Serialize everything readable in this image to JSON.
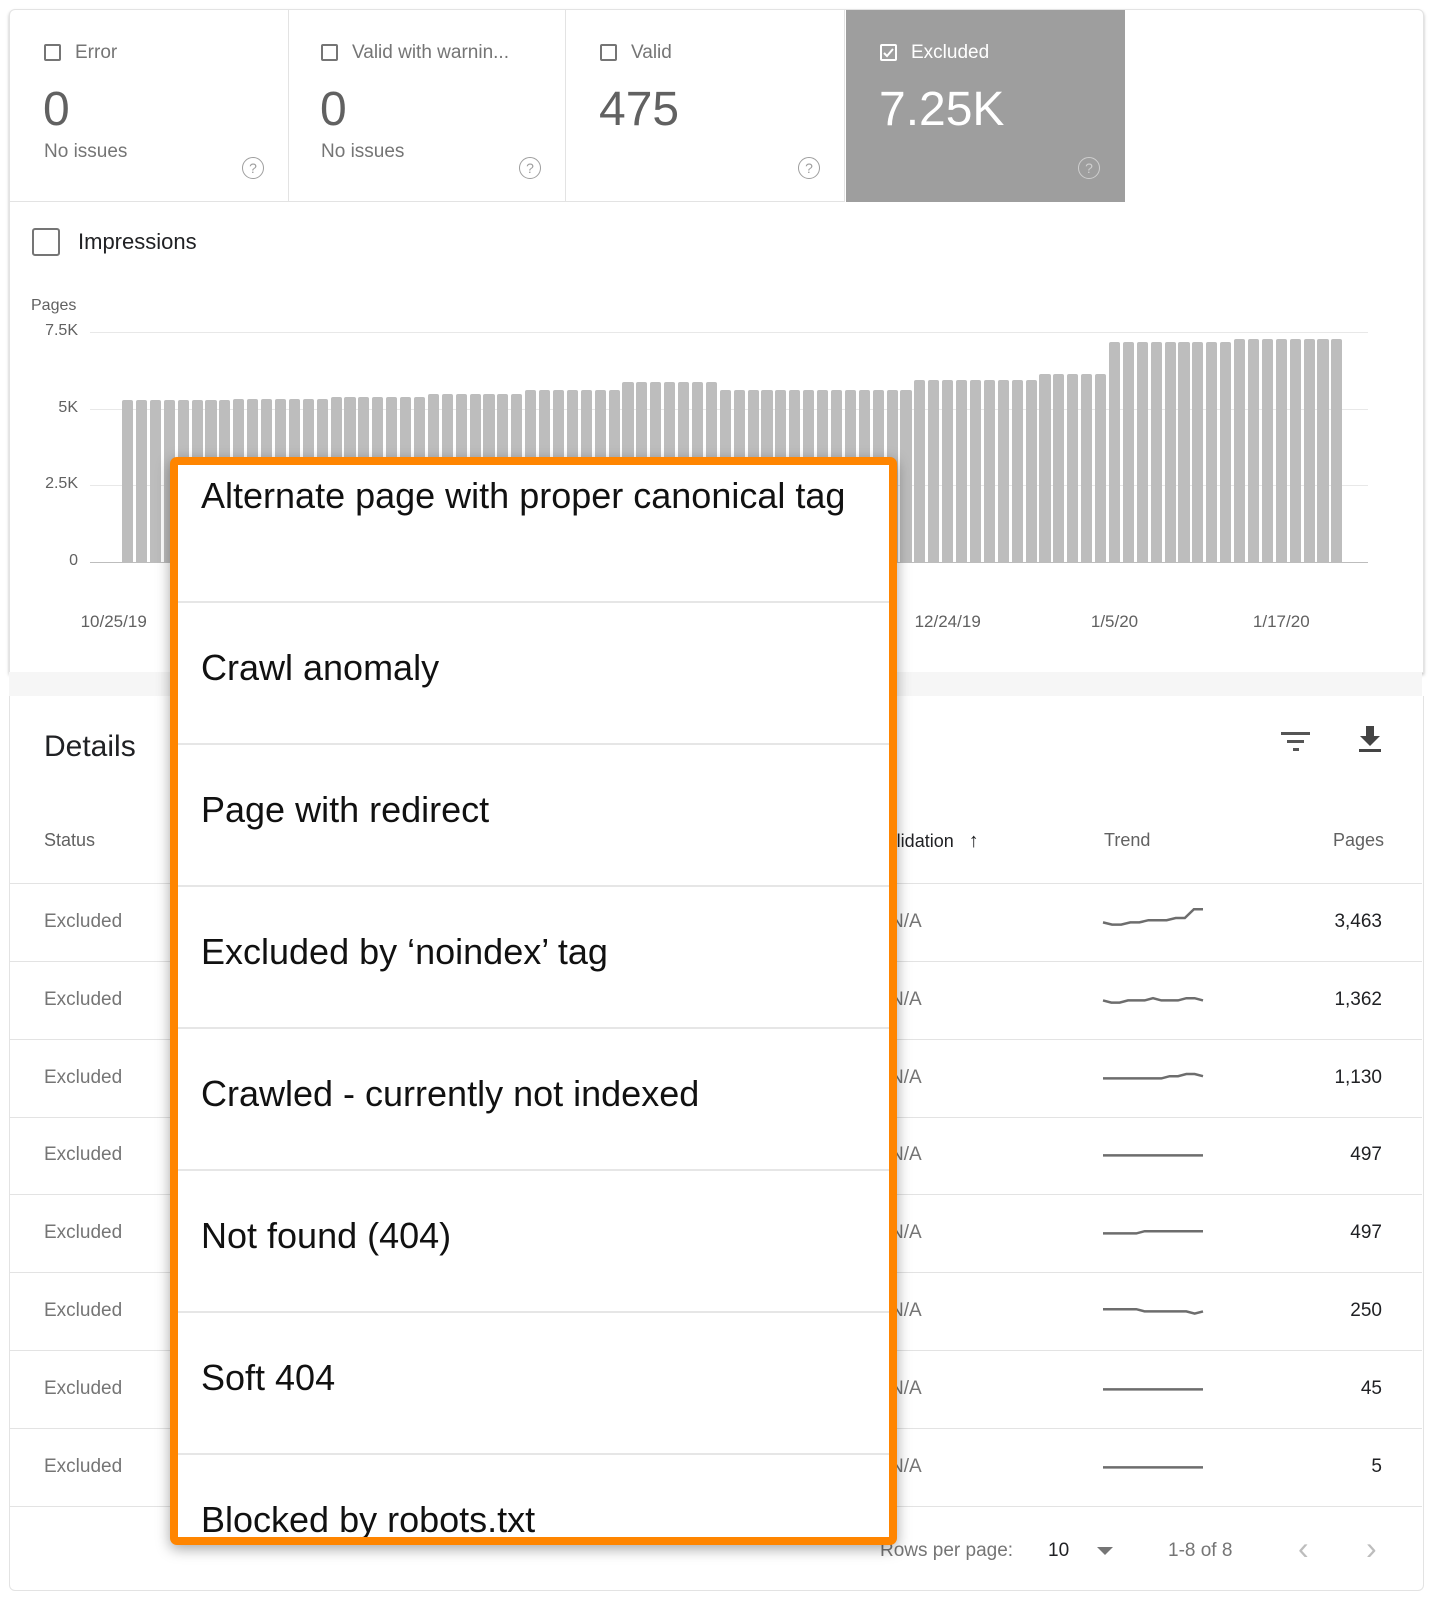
{
  "tiles": [
    {
      "label": "Error",
      "count": "0",
      "sub": "No issues",
      "checked": false
    },
    {
      "label": "Valid with warnin...",
      "count": "0",
      "sub": "No issues",
      "checked": false
    },
    {
      "label": "Valid",
      "count": "475",
      "sub": "",
      "checked": false
    },
    {
      "label": "Excluded",
      "count": "7.25K",
      "sub": "",
      "checked": true
    }
  ],
  "help_glyph": "?",
  "impressions_label": "Impressions",
  "colors": {
    "accent_highlight": "#ff8500",
    "selected_tile": "#9e9e9e",
    "bar": "#bdbdbd"
  },
  "chart_data": {
    "type": "bar",
    "ylabel": "Pages",
    "ylim": [
      0,
      7500
    ],
    "yticks": [
      "0",
      "2.5K",
      "5K",
      "7.5K"
    ],
    "ytick_values": [
      0,
      2500,
      5000,
      7500
    ],
    "grid": true,
    "xtick_labels": [
      "10/25/19",
      "12/24/19",
      "1/5/20",
      "1/17/20"
    ],
    "x": [
      "10/26/19",
      "10/27/19",
      "10/28/19",
      "10/29/19",
      "10/30/19",
      "10/31/19",
      "11/1/19",
      "11/2/19",
      "11/3/19",
      "11/4/19",
      "11/5/19",
      "11/6/19",
      "11/7/19",
      "11/8/19",
      "11/9/19",
      "11/10/19",
      "11/11/19",
      "11/12/19",
      "11/13/19",
      "11/14/19",
      "11/15/19",
      "11/16/19",
      "11/17/19",
      "11/18/19",
      "11/19/19",
      "11/20/19",
      "11/21/19",
      "11/22/19",
      "11/23/19",
      "11/24/19",
      "11/25/19",
      "11/26/19",
      "11/27/19",
      "11/28/19",
      "11/29/19",
      "11/30/19",
      "12/1/19",
      "12/2/19",
      "12/3/19",
      "12/4/19",
      "12/5/19",
      "12/6/19",
      "12/7/19",
      "12/8/19",
      "12/9/19",
      "12/10/19",
      "12/11/19",
      "12/12/19",
      "12/13/19",
      "12/14/19",
      "12/15/19",
      "12/16/19",
      "12/17/19",
      "12/18/19",
      "12/19/19",
      "12/20/19",
      "12/21/19",
      "12/22/19",
      "12/23/19",
      "12/24/19",
      "12/25/19",
      "12/26/19",
      "12/27/19",
      "12/28/19",
      "12/29/19",
      "12/30/19",
      "12/31/19",
      "1/1/20",
      "1/2/20",
      "1/3/20",
      "1/4/20",
      "1/5/20",
      "1/6/20",
      "1/7/20",
      "1/8/20",
      "1/9/20",
      "1/10/20",
      "1/11/20",
      "1/12/20",
      "1/13/20",
      "1/14/20",
      "1/15/20",
      "1/16/20",
      "1/17/20",
      "1/18/20",
      "1/19/20",
      "1/20/20",
      "1/21/20"
    ],
    "values": [
      5270,
      5270,
      5270,
      5270,
      5270,
      5270,
      5270,
      5270,
      5310,
      5310,
      5310,
      5310,
      5310,
      5310,
      5310,
      5370,
      5370,
      5370,
      5370,
      5370,
      5370,
      5370,
      5470,
      5470,
      5470,
      5470,
      5470,
      5470,
      5470,
      5620,
      5620,
      5620,
      5620,
      5620,
      5620,
      5620,
      5880,
      5880,
      5880,
      5880,
      5880,
      5880,
      5880,
      5620,
      5620,
      5620,
      5620,
      5620,
      5620,
      5620,
      5620,
      5620,
      5620,
      5620,
      5620,
      5620,
      5620,
      5920,
      5920,
      5920,
      5920,
      5920,
      5920,
      5920,
      5920,
      5920,
      6120,
      6120,
      6120,
      6120,
      6120,
      7170,
      7170,
      7170,
      7170,
      7170,
      7170,
      7170,
      7170,
      7170,
      7270,
      7270,
      7270,
      7270,
      7270,
      7270,
      7270,
      7270
    ]
  },
  "details": {
    "title": "Details",
    "filter_icon": "filter-icon",
    "download_icon": "download-icon",
    "columns": {
      "status": "Status",
      "validation": "Validation",
      "trend": "Trend",
      "pages": "Pages"
    },
    "sort_glyph": "↑",
    "rows": [
      {
        "status": "Excluded",
        "validation": "N/A",
        "pages": "3,463",
        "trend": [
          3,
          2,
          2,
          3,
          3,
          4,
          4,
          4,
          5,
          5,
          9,
          9
        ]
      },
      {
        "status": "Excluded",
        "validation": "N/A",
        "pages": "1,362",
        "trend": [
          3,
          2,
          2,
          3,
          3,
          3,
          4,
          3,
          3,
          3,
          4,
          4,
          3
        ]
      },
      {
        "status": "Excluded",
        "validation": "N/A",
        "pages": "1,130",
        "trend": [
          3,
          3,
          3,
          3,
          3,
          3,
          3,
          3,
          4,
          4,
          5,
          5,
          4
        ]
      },
      {
        "status": "Excluded",
        "validation": "N/A",
        "pages": "497",
        "trend": [
          3,
          3,
          3,
          3,
          3,
          3,
          3,
          3,
          3,
          3,
          3,
          3,
          3
        ]
      },
      {
        "status": "Excluded",
        "validation": "N/A",
        "pages": "497",
        "trend": [
          3,
          3,
          3,
          3,
          3,
          4,
          4,
          4,
          4,
          4,
          4,
          4,
          4
        ]
      },
      {
        "status": "Excluded",
        "validation": "N/A",
        "pages": "250",
        "trend": [
          4,
          4,
          4,
          4,
          4,
          3,
          3,
          3,
          3,
          3,
          3,
          2,
          3
        ]
      },
      {
        "status": "Excluded",
        "validation": "N/A",
        "pages": "45",
        "trend": [
          3,
          3,
          3,
          3,
          3,
          3,
          3,
          3,
          3,
          3,
          3,
          3,
          3
        ]
      },
      {
        "status": "Excluded",
        "validation": "N/A",
        "pages": "5",
        "trend": [
          3,
          3,
          3,
          3,
          3,
          3,
          3,
          3,
          3,
          3,
          3,
          3,
          3
        ]
      }
    ]
  },
  "popup_items": [
    "Alternate page with proper canonical tag",
    "Crawl anomaly",
    "Page with redirect",
    "Excluded by ‘noindex’ tag",
    "Crawled - currently not indexed",
    "Not found (404)",
    "Soft 404",
    "Blocked by robots.txt"
  ],
  "pagination": {
    "rows_per_page_label": "Rows per page:",
    "rows_per_page": "10",
    "range": "1-8 of 8",
    "prev": "‹",
    "next": "›"
  }
}
